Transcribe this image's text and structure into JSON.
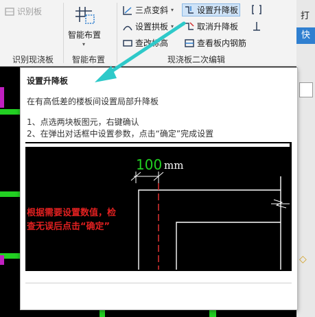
{
  "ribbon": {
    "group1": {
      "label": "识别现浇板",
      "button": "识别板"
    },
    "group2": {
      "label": "智能布置",
      "button": "智能布置"
    },
    "group3": {
      "label": "现浇板二次编辑",
      "items": {
        "three_point": "三点变斜",
        "set_raise": "设置升降板",
        "set_arch": "设置拱板",
        "cancel_raise": "取消升降板",
        "check_label": "查改标高",
        "view_rebar": "查看板内钢筋"
      }
    }
  },
  "right_strip": {
    "top_char": "打",
    "blue_char": "快"
  },
  "tooltip": {
    "title": "设置升降板",
    "description": "在有高低差的楼板间设置局部升降板",
    "step1": "1、点选两块板图元，右键确认",
    "step2": "2、在弹出对话框中设置参数，点击“确定”完成设置",
    "image": {
      "dimension_value": "100",
      "dimension_unit": "mm",
      "note_line1": "根据需要设置数值，检",
      "note_line2": "查无误后点击“确定”"
    }
  },
  "colors": {
    "arrow": "#2ec9c9",
    "dimension_text": "#22d022",
    "note_text": "#e02020",
    "dash_line": "#d03030"
  }
}
